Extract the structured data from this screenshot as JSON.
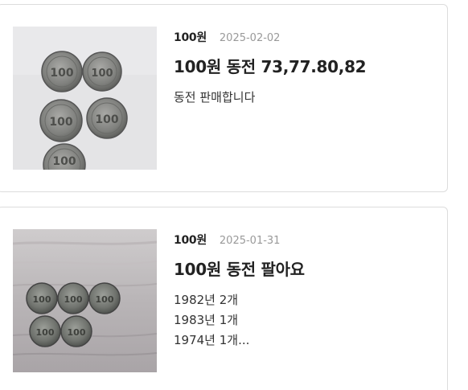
{
  "listings": [
    {
      "category": "100원",
      "date": "2025-02-02",
      "title": "100원 동전 73,77.80,82",
      "description_lines": [
        "동전 판매합니다"
      ],
      "coin_label": "100"
    },
    {
      "category": "100원",
      "date": "2025-01-31",
      "title": "100원 동전 팔아요",
      "description_lines": [
        "1982년 2개",
        "1983년 1개",
        "1974년 1개..."
      ],
      "coin_label": "100"
    }
  ]
}
